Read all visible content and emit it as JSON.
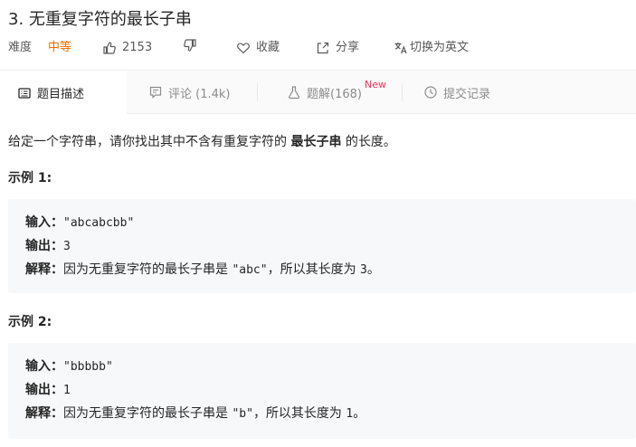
{
  "problem": {
    "title": "3. 无重复字符的最长子串",
    "difficulty_label": "难度",
    "difficulty_value": "中等",
    "likes": "2153",
    "favorite_label": "收藏",
    "share_label": "分享",
    "lang_switch_label": "切换为英文"
  },
  "tabs": [
    {
      "label": "题目描述",
      "icon": "description-icon"
    },
    {
      "label": "评论 (1.4k)",
      "icon": "comment-icon"
    },
    {
      "label": "题解(168)",
      "icon": "flask-icon",
      "badge": "New"
    },
    {
      "label": "提交记录",
      "icon": "clock-icon"
    }
  ],
  "description": {
    "prefix": "给定一个字符串，请你找出其中不含有重复字符的 ",
    "bold": "最长子串",
    "suffix": " 的长度。"
  },
  "examples": [
    {
      "title": "示例 1:",
      "input_label": "输入：",
      "input_value": "\"abcabcbb\"",
      "output_label": "输出：",
      "output_value": "3",
      "explain_label": "解释：",
      "explain_prefix": "因为无重复字符的最长子串是 ",
      "explain_code": "\"abc\"",
      "explain_mid": "，所以其长度为 ",
      "explain_num": "3",
      "explain_end": "。"
    },
    {
      "title": "示例 2:",
      "input_label": "输入：",
      "input_value": "\"bbbbb\"",
      "output_label": "输出：",
      "output_value": "1",
      "explain_label": "解释：",
      "explain_prefix": "因为无重复字符的最长子串是 ",
      "explain_code": "\"b\"",
      "explain_mid": "，所以其长度为 ",
      "explain_num": "1",
      "explain_end": "。"
    }
  ],
  "colors": {
    "difficulty_medium": "#ef6c00",
    "new_badge": "#ff2d55",
    "example_bg": "#f7f8fa",
    "tabbar_bg": "#fafafa"
  }
}
